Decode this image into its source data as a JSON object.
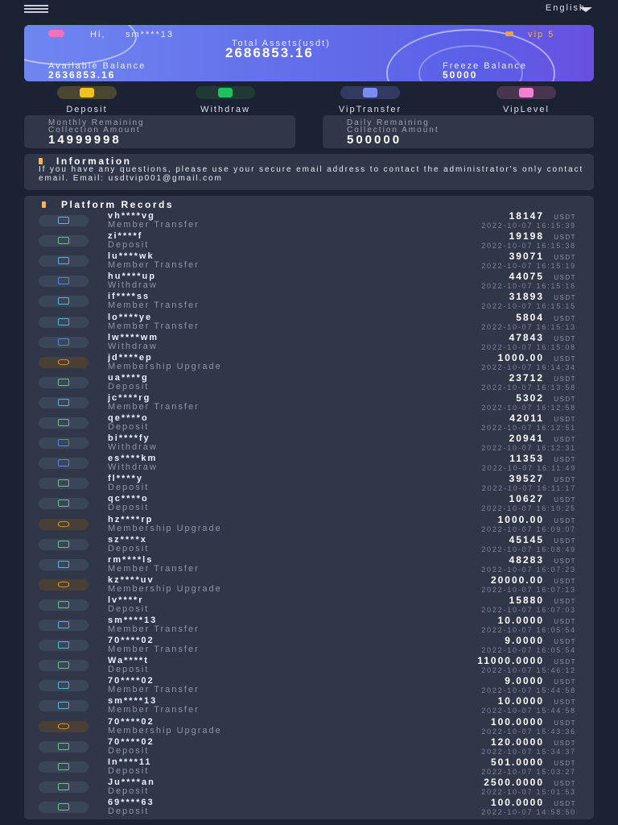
{
  "header": {
    "language": "English"
  },
  "account": {
    "greeting": "Hi,",
    "username": "sm****13",
    "vip": "vip 5",
    "total_label": "Total Assets(usdt)",
    "total": "2686853.16",
    "available_label": "Available Balance",
    "available": "2636853.16",
    "freeze_label": "Freeze Balance",
    "freeze": "50000"
  },
  "actions": [
    {
      "label": "Deposit",
      "color": "#f0c020",
      "bg": "#4a4630"
    },
    {
      "label": "Withdraw",
      "color": "#20c060",
      "bg": "#1f3a35"
    },
    {
      "label": "VipTransfer",
      "color": "#7b8cf0",
      "bg": "#333a62"
    },
    {
      "label": "VipLevel",
      "color": "#f080d0",
      "bg": "#4a3550"
    }
  ],
  "limits": {
    "monthly_label": "Monthly Remaining\nCollection Amount",
    "monthly": "14999998",
    "daily_label": "Daily Remaining\nCollection Amount",
    "daily": "500000"
  },
  "information": {
    "title": "Information",
    "text": "If you have any questions, please use your secure email address to contact the administrator's only contact email. Email:  usdtvip001@gmail.com"
  },
  "records": {
    "title": "Platform Records",
    "unit": "USDT",
    "type_colors": {
      "Member Transfer": "#5fb0dc",
      "Deposit": "#6fbf8a",
      "Withdraw": "#5a84e6",
      "Membership Upgrade": "#f0a030"
    },
    "items": [
      {
        "name": "vh****vg",
        "type": "Member Transfer",
        "amount": "18147",
        "time": "2022-10-07 16:15:39"
      },
      {
        "name": "zi****f",
        "type": "Deposit",
        "amount": "19198",
        "time": "2022-10-07 16:15:38"
      },
      {
        "name": "lu****wk",
        "type": "Member Transfer",
        "amount": "39071",
        "time": "2022-10-07 16:15:19"
      },
      {
        "name": "hu****up",
        "type": "Withdraw",
        "amount": "44075",
        "time": "2022-10-07 16:15:16"
      },
      {
        "name": "if****ss",
        "type": "Member Transfer",
        "amount": "31893",
        "time": "2022-10-07 16:15:15"
      },
      {
        "name": "lo****ye",
        "type": "Member Transfer",
        "amount": "5804",
        "time": "2022-10-07 16:15:13"
      },
      {
        "name": "lw****wm",
        "type": "Withdraw",
        "amount": "47843",
        "time": "2022-10-07 16:15:08"
      },
      {
        "name": "jd****ep",
        "type": "Membership Upgrade",
        "amount": "1000.00",
        "time": "2022-10-07 16:14:34"
      },
      {
        "name": "ua****g",
        "type": "Deposit",
        "amount": "23712",
        "time": "2022-10-07 16:13:58"
      },
      {
        "name": "jc****rg",
        "type": "Member Transfer",
        "amount": "5302",
        "time": "2022-10-07 16:12:58"
      },
      {
        "name": "qe****o",
        "type": "Deposit",
        "amount": "42011",
        "time": "2022-10-07 16:12:51"
      },
      {
        "name": "bi****fy",
        "type": "Withdraw",
        "amount": "20941",
        "time": "2022-10-07 16:12:31"
      },
      {
        "name": "es****km",
        "type": "Withdraw",
        "amount": "11353",
        "time": "2022-10-07 16:11:49"
      },
      {
        "name": "fl****y",
        "type": "Deposit",
        "amount": "39527",
        "time": "2022-10-07 16:11:17"
      },
      {
        "name": "qc****o",
        "type": "Deposit",
        "amount": "10627",
        "time": "2022-10-07 16:10:25"
      },
      {
        "name": "hz****rp",
        "type": "Membership Upgrade",
        "amount": "1000.00",
        "time": "2022-10-07 16:09:07"
      },
      {
        "name": "sz****x",
        "type": "Deposit",
        "amount": "45145",
        "time": "2022-10-07 16:08:49"
      },
      {
        "name": "rm****ls",
        "type": "Member Transfer",
        "amount": "48283",
        "time": "2022-10-07 16:07:23"
      },
      {
        "name": "kz****uv",
        "type": "Membership Upgrade",
        "amount": "20000.00",
        "time": "2022-10-07 16:07:13"
      },
      {
        "name": "lv****r",
        "type": "Deposit",
        "amount": "15880",
        "time": "2022-10-07 16:07:03"
      },
      {
        "name": "sm****13",
        "type": "Member Transfer",
        "amount": "10.0000",
        "time": "2022-10-07 16:05:54"
      },
      {
        "name": "70****02",
        "type": "Member Transfer",
        "amount": "9.0000",
        "time": "2022-10-07 16:05:54"
      },
      {
        "name": "Wa****t",
        "type": "Deposit",
        "amount": "11000.0000",
        "time": "2022-10-07 15:46:12"
      },
      {
        "name": "70****02",
        "type": "Member Transfer",
        "amount": "9.0000",
        "time": "2022-10-07 15:44:58"
      },
      {
        "name": "sm****13",
        "type": "Member Transfer",
        "amount": "10.0000",
        "time": "2022-10-07 15:44:58"
      },
      {
        "name": "70****02",
        "type": "Membership Upgrade",
        "amount": "100.0000",
        "time": "2022-10-07 15:43:36"
      },
      {
        "name": "70****02",
        "type": "Deposit",
        "amount": "120.0000",
        "time": "2022-10-07 15:34:37"
      },
      {
        "name": "In****11",
        "type": "Deposit",
        "amount": "501.0000",
        "time": "2022-10-07 15:03:27"
      },
      {
        "name": "Ju****an",
        "type": "Deposit",
        "amount": "2500.0000",
        "time": "2022-10-07 15:01:53"
      },
      {
        "name": "69****63",
        "type": "Deposit",
        "amount": "100.0000",
        "time": "2022-10-07 14:58:50"
      }
    ]
  }
}
